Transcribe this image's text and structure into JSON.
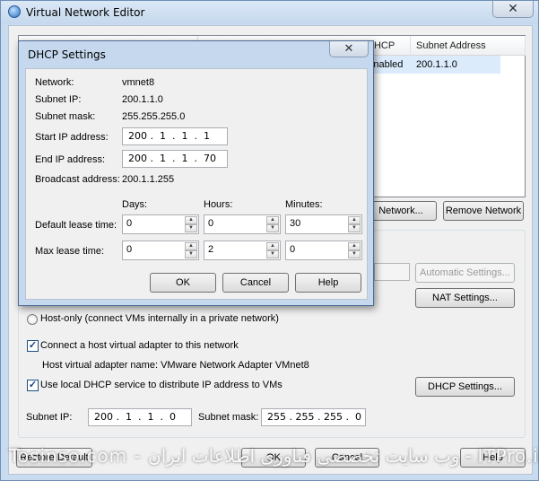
{
  "window": {
    "title": "Virtual Network Editor",
    "close": "✕"
  },
  "network_list": {
    "columns": [
      "DHCP",
      "Subnet Address"
    ],
    "row": {
      "dhcp": "Enabled",
      "subnet": "200.1.1.0"
    }
  },
  "network_buttons": {
    "add": "Network...",
    "remove": "Remove Network"
  },
  "nat": {
    "automatic_settings": "Automatic Settings...",
    "nat_settings": "NAT Settings..."
  },
  "host_only": {
    "label": "Host-only (connect VMs internally in a private network)"
  },
  "connect_adapter": {
    "label": "Connect a host virtual adapter to this network",
    "checked": "✓"
  },
  "adapter_name": "Host virtual adapter name: VMware Network Adapter VMnet8",
  "use_dhcp": {
    "label": "Use local DHCP service to distribute IP address to VMs",
    "checked": "✓",
    "settings_button": "DHCP Settings..."
  },
  "subnet": {
    "ip_label": "Subnet IP:",
    "ip": "200 .  1  .  1  .  0",
    "mask_label": "Subnet mask:",
    "mask": "255 . 255 . 255 .  0"
  },
  "bottom_buttons": {
    "restore": "Restore Default",
    "ok": "OK",
    "cancel": "Cancel",
    "help": "Help"
  },
  "watermark": "Tosinso.com - وب سایت تخصصی فناوری اطلاعات ایران - ITPro.ir",
  "dhcp_dialog": {
    "title": "DHCP Settings",
    "close": "✕",
    "network_label": "Network:",
    "network": "vmnet8",
    "subnet_ip_label": "Subnet IP:",
    "subnet_ip": "200.1.1.0",
    "subnet_mask_label": "Subnet mask:",
    "subnet_mask": "255.255.255.0",
    "start_label": "Start IP address:",
    "start_ip": "200 .  1  .  1  .  1",
    "end_label": "End IP address:",
    "end_ip": "200 .  1  .  1  .  70",
    "broadcast_label": "Broadcast address:",
    "broadcast": "200.1.1.255",
    "col_days": "Days:",
    "col_hours": "Hours:",
    "col_minutes": "Minutes:",
    "default_lease_label": "Default lease time:",
    "default_lease": {
      "days": "0",
      "hours": "0",
      "minutes": "30"
    },
    "max_lease_label": "Max lease time:",
    "max_lease": {
      "days": "0",
      "hours": "2",
      "minutes": "0"
    },
    "ok": "OK",
    "cancel": "Cancel",
    "help": "Help"
  }
}
